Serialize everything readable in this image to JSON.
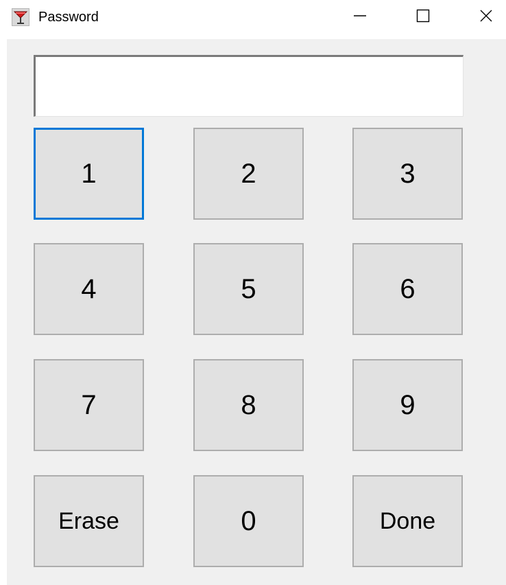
{
  "window": {
    "title": "Password",
    "controls": {
      "minimize": "minimize-icon",
      "maximize": "maximize-icon",
      "close": "close-icon"
    }
  },
  "display": {
    "value": ""
  },
  "keypad": {
    "k1": "1",
    "k2": "2",
    "k3": "3",
    "k4": "4",
    "k5": "5",
    "k6": "6",
    "k7": "7",
    "k8": "8",
    "k9": "9",
    "erase": "Erase",
    "k0": "0",
    "done": "Done",
    "focused_key": "1"
  },
  "colors": {
    "focus": "#0078d7",
    "button_face": "#e1e1e1",
    "button_border": "#adadad",
    "client_bg": "#f0f0f0"
  }
}
